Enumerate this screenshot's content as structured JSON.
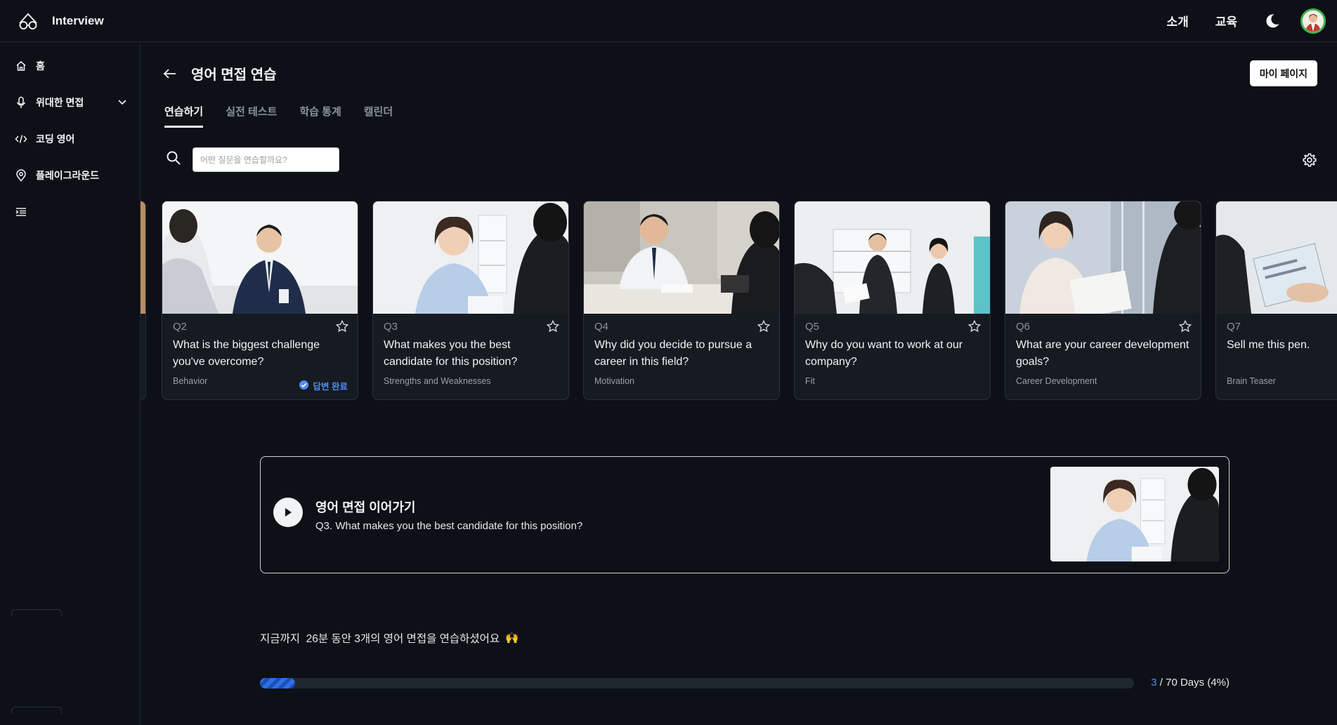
{
  "app": {
    "name": "Interview"
  },
  "topbar": {
    "links": [
      "소개",
      "교육"
    ]
  },
  "sidebar": {
    "items": [
      {
        "label": "홈",
        "icon": "home-icon"
      },
      {
        "label": "위대한 면접",
        "icon": "microphone-icon"
      },
      {
        "label": "코딩 영어",
        "icon": "code-icon"
      },
      {
        "label": "플레이그라운드",
        "icon": "location-pin-icon"
      },
      {
        "label": "",
        "icon": "list-indent-icon"
      }
    ]
  },
  "page": {
    "title": "영어 면접 연습",
    "mypage_label": "마이 페이지",
    "tabs": [
      "연습하기",
      "실전 테스트",
      "학습 통계",
      "캘린더"
    ],
    "active_tab": 0
  },
  "search": {
    "placeholder": "어떤 질문을 연습할까요?"
  },
  "cards": [
    {
      "num": "Q2",
      "question": "What is the biggest challenge you've overcome?",
      "category": "Behavior",
      "done_label": "답변 완료"
    },
    {
      "num": "Q3",
      "question": "What makes you the best candidate for this position?",
      "category": "Strengths and Weaknesses"
    },
    {
      "num": "Q4",
      "question": "Why did you decide to pursue a career in this field?",
      "category": "Motivation"
    },
    {
      "num": "Q5",
      "question": "Why do you want to work at our company?",
      "category": "Fit"
    },
    {
      "num": "Q6",
      "question": "What are your career development goals?",
      "category": "Career Development"
    },
    {
      "num": "Q7",
      "question": "Sell me this pen.",
      "category": "Brain Teaser"
    }
  ],
  "continue": {
    "title": "영어 면접 이어가기",
    "subtitle": "Q3. What makes you the best candidate for this position?"
  },
  "stats": {
    "summary": "지금까지  26분 동안 3개의 영어 면접을 연습하셨어요",
    "emoji": "🙌",
    "progress_current": "3",
    "progress_rest": " / 70 Days (4%)",
    "progress_fraction": 0.04
  },
  "colors": {
    "accent": "#4e8cf2",
    "background": "#0d1117",
    "card": "#161b22",
    "avatar_ring": "#3fb950"
  }
}
